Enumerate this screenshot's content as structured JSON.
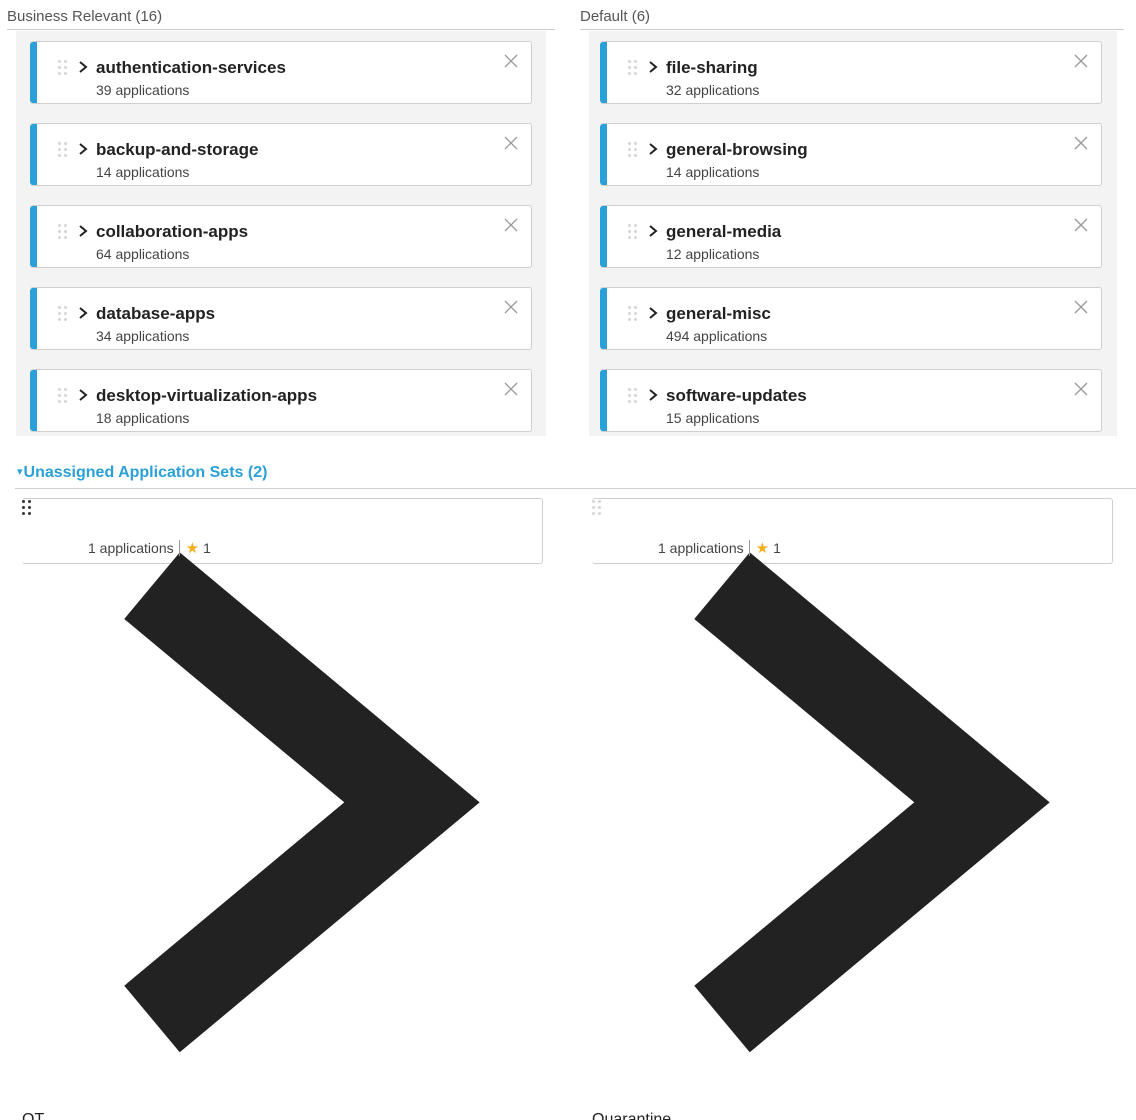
{
  "sections": {
    "business_relevant": {
      "header": "Business Relevant (16)",
      "cards": [
        {
          "name": "authentication-services",
          "count": "39 applications"
        },
        {
          "name": "backup-and-storage",
          "count": "14 applications"
        },
        {
          "name": "collaboration-apps",
          "count": "64 applications"
        },
        {
          "name": "database-apps",
          "count": "34 applications"
        },
        {
          "name": "desktop-virtualization-apps",
          "count": "18 applications"
        }
      ]
    },
    "default": {
      "header": "Default (6)",
      "cards": [
        {
          "name": "file-sharing",
          "count": "32 applications"
        },
        {
          "name": "general-browsing",
          "count": "14 applications"
        },
        {
          "name": "general-media",
          "count": "12 applications"
        },
        {
          "name": "general-misc",
          "count": "494 applications"
        },
        {
          "name": "software-updates",
          "count": "15 applications"
        }
      ]
    }
  },
  "unassigned": {
    "header": "Unassigned Application Sets (2)",
    "toggle_glyph": "▾",
    "cards": [
      {
        "name": "OT",
        "count": "1 applications",
        "favorites": "1"
      },
      {
        "name": "Quarantine",
        "count": "1 applications",
        "favorites": "1"
      }
    ]
  },
  "colors": {
    "business_relevant_stripe": "#2aa0d8",
    "default_stripe": "#2aa0d8",
    "unassigned_stripe": "#f0a41a",
    "accent_link": "#2aa0d8",
    "favorite_star": "#f2b01e"
  },
  "icons": {
    "expand": "chevron-right-icon",
    "remove": "close-icon",
    "reorder": "drag-handle-icon",
    "favorite": "star-icon"
  }
}
